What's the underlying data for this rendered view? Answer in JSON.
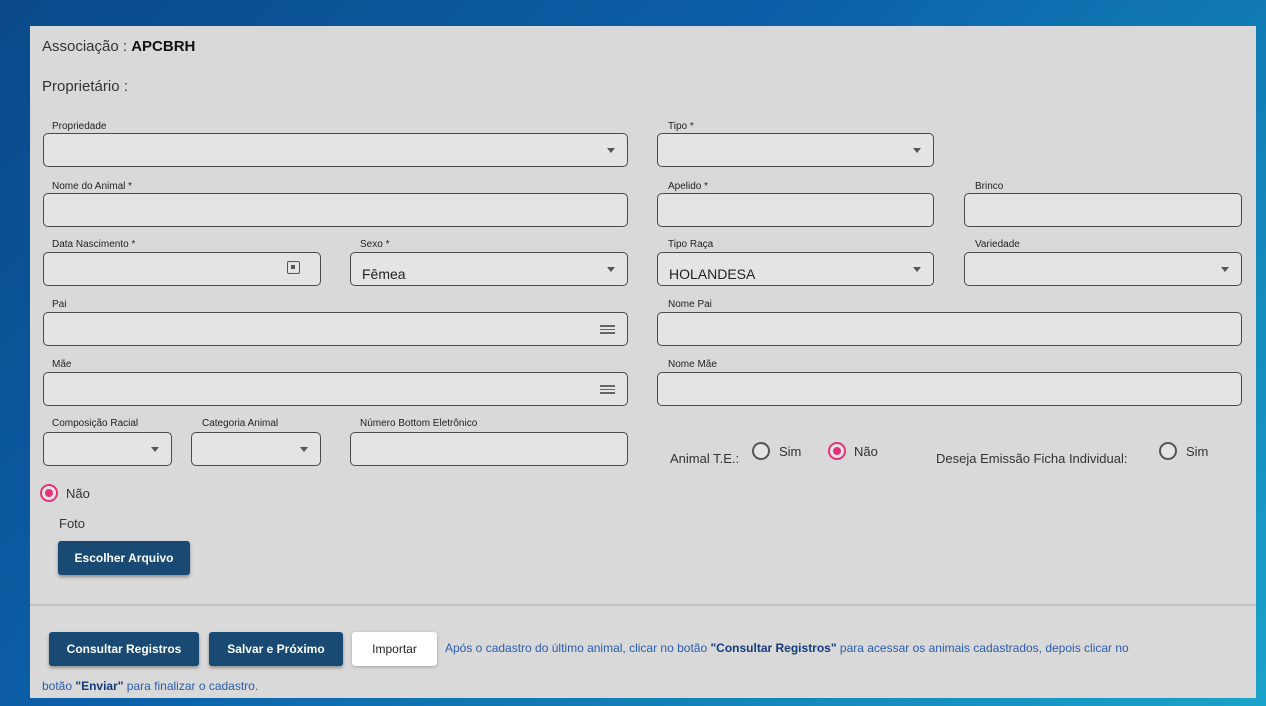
{
  "header": {
    "associacao_label": "Associação :",
    "associacao_value": "APCBRH",
    "proprietario_label": "Proprietário :"
  },
  "fields": {
    "propriedade": {
      "label": "Propriedade",
      "value": ""
    },
    "tipo": {
      "label": "Tipo *",
      "value": ""
    },
    "nome_animal": {
      "label": "Nome do Animal *",
      "value": ""
    },
    "apelido": {
      "label": "Apelido *",
      "value": ""
    },
    "brinco": {
      "label": "Brinco",
      "value": ""
    },
    "data_nascimento": {
      "label": "Data Nascimento *",
      "value": ""
    },
    "sexo": {
      "label": "Sexo *",
      "value": "Fêmea"
    },
    "tipo_raca": {
      "label": "Tipo Raça",
      "value": "HOLANDESA"
    },
    "variedade": {
      "label": "Variedade",
      "value": ""
    },
    "pai": {
      "label": "Pai",
      "value": ""
    },
    "nome_pai": {
      "label": "Nome Pai",
      "value": ""
    },
    "mae": {
      "label": "Mãe",
      "value": ""
    },
    "nome_mae": {
      "label": "Nome Mãe",
      "value": ""
    },
    "composicao_racial": {
      "label": "Composição Racial",
      "value": ""
    },
    "categoria_animal": {
      "label": "Categoria Animal",
      "value": ""
    },
    "numero_bottom": {
      "label": "Número Bottom Eletrônico",
      "value": ""
    }
  },
  "animal_te": {
    "label": "Animal T.E.:",
    "options": [
      {
        "label": "Sim",
        "selected": false
      },
      {
        "label": "Não",
        "selected": true
      }
    ]
  },
  "ficha_individual": {
    "label": "Deseja Emissão Ficha Individual:",
    "options": [
      {
        "label": "Sim",
        "selected": false
      },
      {
        "label": "Não",
        "selected": true
      }
    ]
  },
  "foto": {
    "label": "Foto",
    "button": "Escolher Arquivo"
  },
  "actions": {
    "consultar": "Consultar Registros",
    "salvar": "Salvar e Próximo",
    "importar": "Importar"
  },
  "note": {
    "part1": "Após o cadastro do último animal, clicar no botão ",
    "bold1": "\"Consultar Registros\"",
    "part2": " para acessar os animais cadastrados, depois clicar no",
    "part3": "botão ",
    "bold2": "\"Enviar\"",
    "part4": " para finalizar o cadastro."
  },
  "colors": {
    "primary_button": "#184a73",
    "radio_selected": "#e2337a",
    "panel": "#d9d9d9",
    "note_text": "#2a5db0"
  }
}
